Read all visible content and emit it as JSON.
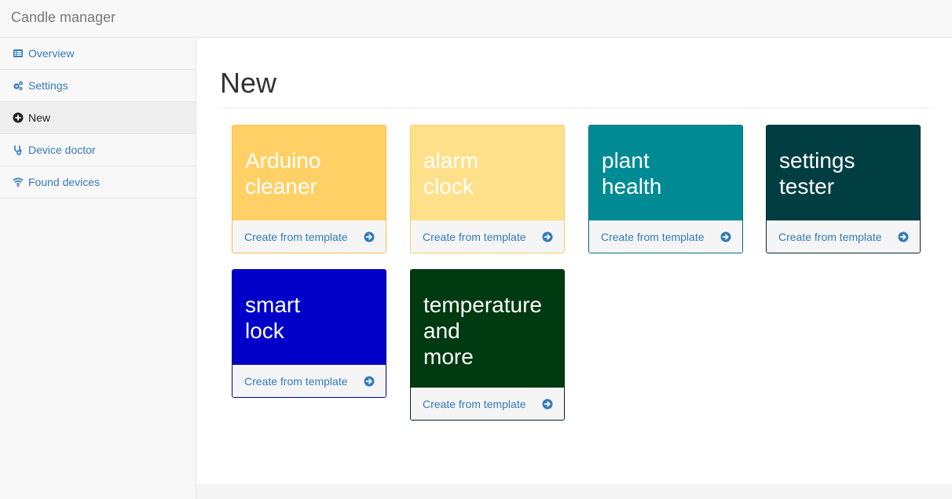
{
  "app": {
    "title": "Candle manager"
  },
  "sidebar": {
    "items": [
      {
        "label": "Overview",
        "icon": "list-icon",
        "active": false
      },
      {
        "label": "Settings",
        "icon": "gears-icon",
        "active": false
      },
      {
        "label": "New",
        "icon": "plus-circle-icon",
        "active": true
      },
      {
        "label": "Device doctor",
        "icon": "stethoscope-icon",
        "active": false
      },
      {
        "label": "Found devices",
        "icon": "wifi-icon",
        "active": false
      }
    ]
  },
  "main": {
    "title": "New",
    "cards": [
      {
        "line1": "Arduino",
        "line2": "cleaner",
        "line3": "",
        "action": "Create from template",
        "color": "#ffd066",
        "border": "#f5c04a"
      },
      {
        "line1": "alarm",
        "line2": "clock",
        "line3": "",
        "action": "Create from template",
        "color": "#ffe08a",
        "border": "#f5cf6a"
      },
      {
        "line1": "plant",
        "line2": "health",
        "line3": "",
        "action": "Create from template",
        "color": "#008b94",
        "border": "#006e75"
      },
      {
        "line1": "settings",
        "line2": "tester",
        "line3": "",
        "action": "Create from template",
        "color": "#003e42",
        "border": "#00292c"
      },
      {
        "line1": "smart",
        "line2": "lock",
        "line3": "",
        "action": "Create from template",
        "color": "#0000c8",
        "border": "#00009a"
      },
      {
        "line1": "temperature",
        "line2": "and",
        "line3": "more",
        "action": "Create from template",
        "color": "#003a10",
        "border": "#002a0b"
      }
    ]
  }
}
